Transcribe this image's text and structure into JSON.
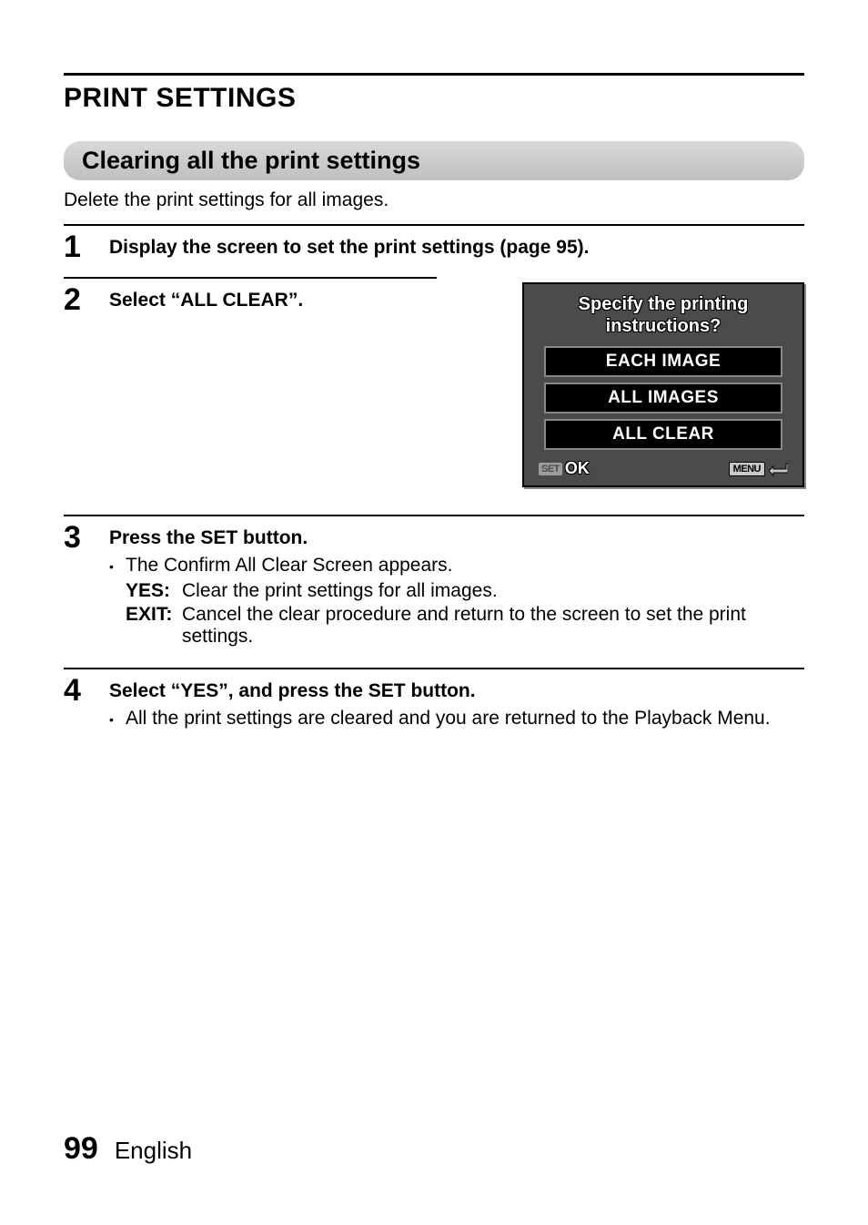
{
  "page": {
    "title": "PRINT SETTINGS",
    "number": "99",
    "language": "English"
  },
  "section": {
    "header": "Clearing all the print settings",
    "description": "Delete the print settings for all images."
  },
  "steps": [
    {
      "num": "1",
      "heading": "Display the screen to set the print settings (page 95)."
    },
    {
      "num": "2",
      "heading": "Select “ALL CLEAR”."
    },
    {
      "num": "3",
      "heading": "Press the SET button.",
      "bullets": [
        "The Confirm All Clear Screen appears."
      ],
      "defs": [
        {
          "label": "YES:",
          "text": "Clear the print settings for all images."
        },
        {
          "label": "EXIT:",
          "text": "Cancel the clear procedure and return to the screen to set the print settings."
        }
      ]
    },
    {
      "num": "4",
      "heading": "Select “YES”, and press the SET button.",
      "bullets": [
        "All the print settings are cleared and you are returned to the Playback Menu."
      ]
    }
  ],
  "device": {
    "title_line1": "Specify the printing",
    "title_line2": "instructions?",
    "options": [
      "EACH IMAGE",
      "ALL IMAGES",
      "ALL CLEAR"
    ],
    "set_label": "SET",
    "ok_label": "OK",
    "menu_label": "MENU"
  }
}
